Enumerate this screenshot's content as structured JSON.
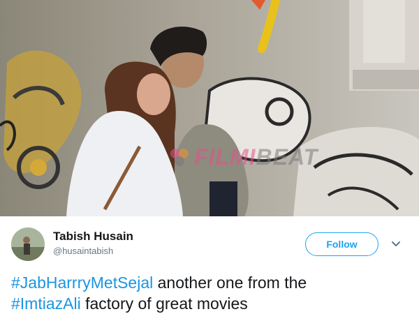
{
  "photo": {
    "alt": "",
    "watermark": {
      "brand_part1": "FILMI",
      "brand_part2": "BEAT"
    }
  },
  "tweet": {
    "author_name": "Tabish Husain",
    "author_handle": "@husaintabish",
    "follow_label": "Follow",
    "text_line1": {
      "hashtag": "#JabHarrryMetSejal",
      "rest": " another one from the"
    },
    "text_line2": {
      "hashtag": "#ImtiazAli",
      "rest": " factory of great movies"
    }
  },
  "colors": {
    "accent": "#1da1f2",
    "hashtag": "#1b95e0",
    "text": "#14171a",
    "muted": "#657786"
  },
  "icons": {
    "more": "chevron-down-icon",
    "watermark_logo": "filmibeat-logo-icon"
  }
}
